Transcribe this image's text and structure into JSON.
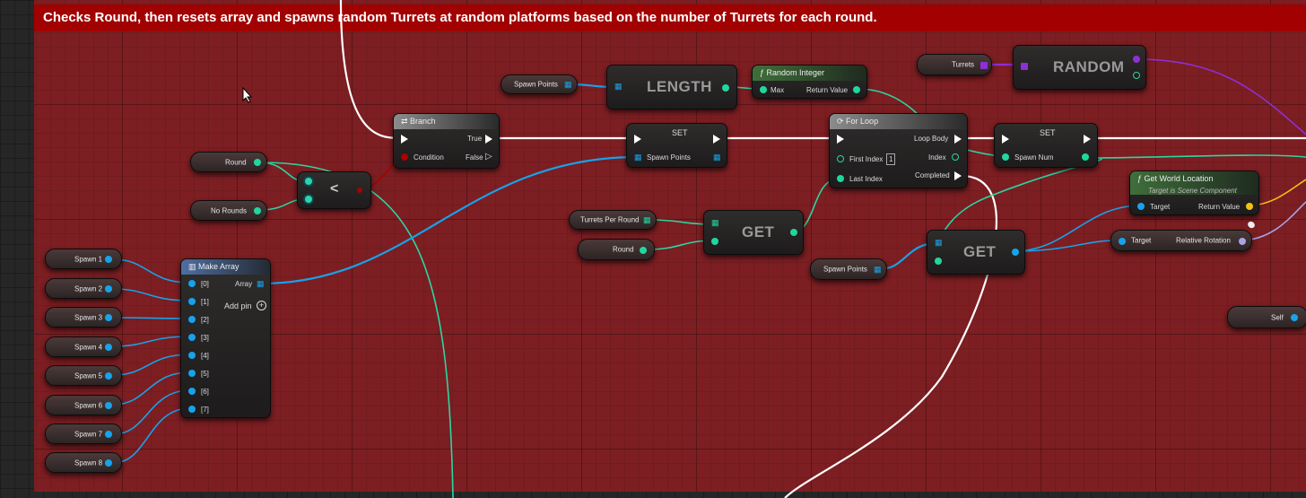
{
  "comment": {
    "text": "Checks Round, then resets array and spawns random Turrets at random platforms based on the number of Turrets for each round."
  },
  "vars": {
    "round1": "Round",
    "no_rounds": "No Rounds",
    "spawn_points_top": "Spawn Points",
    "turrets": "Turrets",
    "turrets_per_round": "Turrets Per Round",
    "round2": "Round",
    "spawn_points_bottom": "Spawn Points",
    "self": "Self",
    "spawns": [
      "Spawn 1",
      "Spawn 2",
      "Spawn 3",
      "Spawn 4",
      "Spawn 5",
      "Spawn 6",
      "Spawn 7",
      "Spawn 8"
    ]
  },
  "nodes": {
    "branch": {
      "title": "Branch",
      "true": "True",
      "false": "False",
      "condition": "Condition"
    },
    "less": {
      "op": "<"
    },
    "length": {
      "title": "LENGTH"
    },
    "random_integer": {
      "title": "Random Integer",
      "max": "Max",
      "return": "Return Value"
    },
    "random": {
      "title": "RANDOM"
    },
    "set1": {
      "title": "SET",
      "pin": "Spawn Points"
    },
    "for_loop": {
      "title": "For Loop",
      "first_index": "First Index",
      "first_index_value": "1",
      "last_index": "Last Index",
      "loop_body": "Loop Body",
      "index": "Index",
      "completed": "Completed"
    },
    "set2": {
      "title": "SET",
      "pin": "Spawn Num"
    },
    "get_world_location": {
      "title": "Get World Location",
      "subtitle": "Target is Scene Component",
      "target": "Target",
      "return": "Return Value"
    },
    "make_array": {
      "title": "Make Array",
      "array": "Array",
      "add_pin": "Add pin",
      "pins": [
        "[0]",
        "[1]",
        "[2]",
        "[3]",
        "[4]",
        "[5]",
        "[6]",
        "[7]"
      ]
    },
    "get1": {
      "title": "GET"
    },
    "get2": {
      "title": "GET"
    },
    "relative_rotation": {
      "target": "Target",
      "output": "Relative Rotation"
    }
  },
  "colors": {
    "comment_header": "#a10101",
    "comment_body": "#7c1e22",
    "exec_wire": "#ffffff",
    "object_wire": "#17a2ea",
    "int_wire": "#1fd79e",
    "class_wire": "#8e2fd6",
    "vector_wire": "#f5c114",
    "rotator_wire": "#a9a2e6"
  }
}
